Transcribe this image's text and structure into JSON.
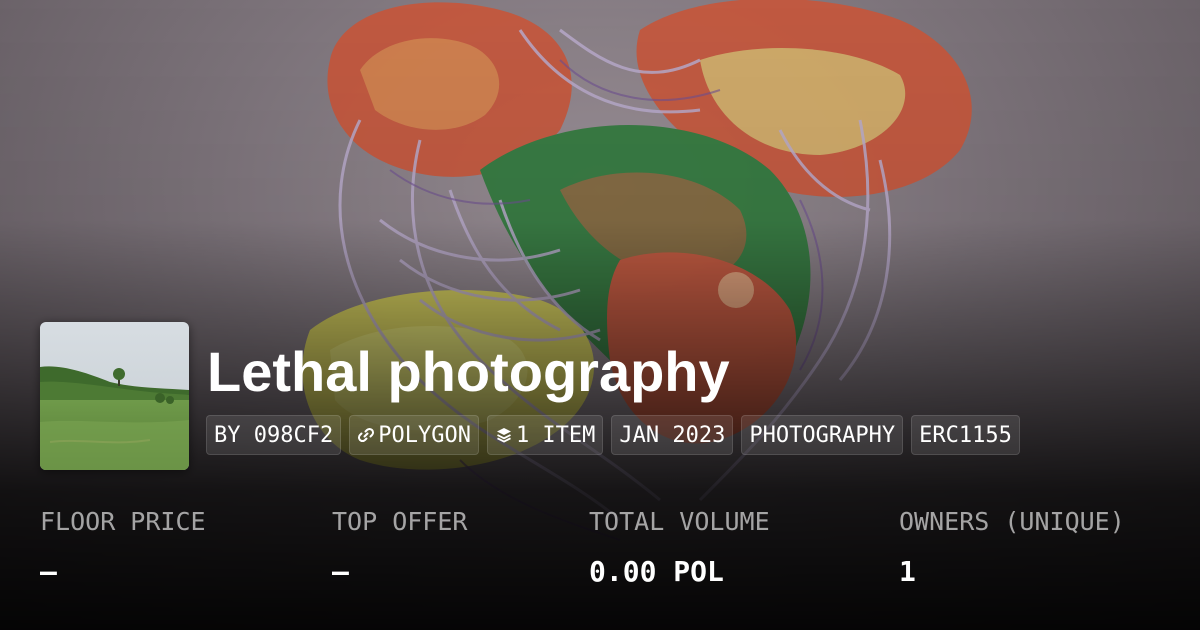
{
  "collection": {
    "title": "Lethal photography",
    "tags": [
      {
        "label": "BY 098CF2",
        "icon": ""
      },
      {
        "label": "POLYGON",
        "icon": "link-icon"
      },
      {
        "label": "1 ITEM",
        "icon": "layers-icon"
      },
      {
        "label": "JAN 2023",
        "icon": ""
      },
      {
        "label": "PHOTOGRAPHY",
        "icon": ""
      },
      {
        "label": "ERC1155",
        "icon": ""
      }
    ]
  },
  "stats": [
    {
      "label": "FLOOR PRICE",
      "value": "–"
    },
    {
      "label": "TOP OFFER",
      "value": "–"
    },
    {
      "label": "TOTAL VOLUME",
      "value": "0.00 POL"
    },
    {
      "label": "OWNERS (UNIQUE)",
      "value": "1"
    }
  ],
  "colors": {
    "text": "#ffffff",
    "muted_text": "#b4b4b4",
    "tag_background": "rgba(255,255,255,0.10)"
  }
}
